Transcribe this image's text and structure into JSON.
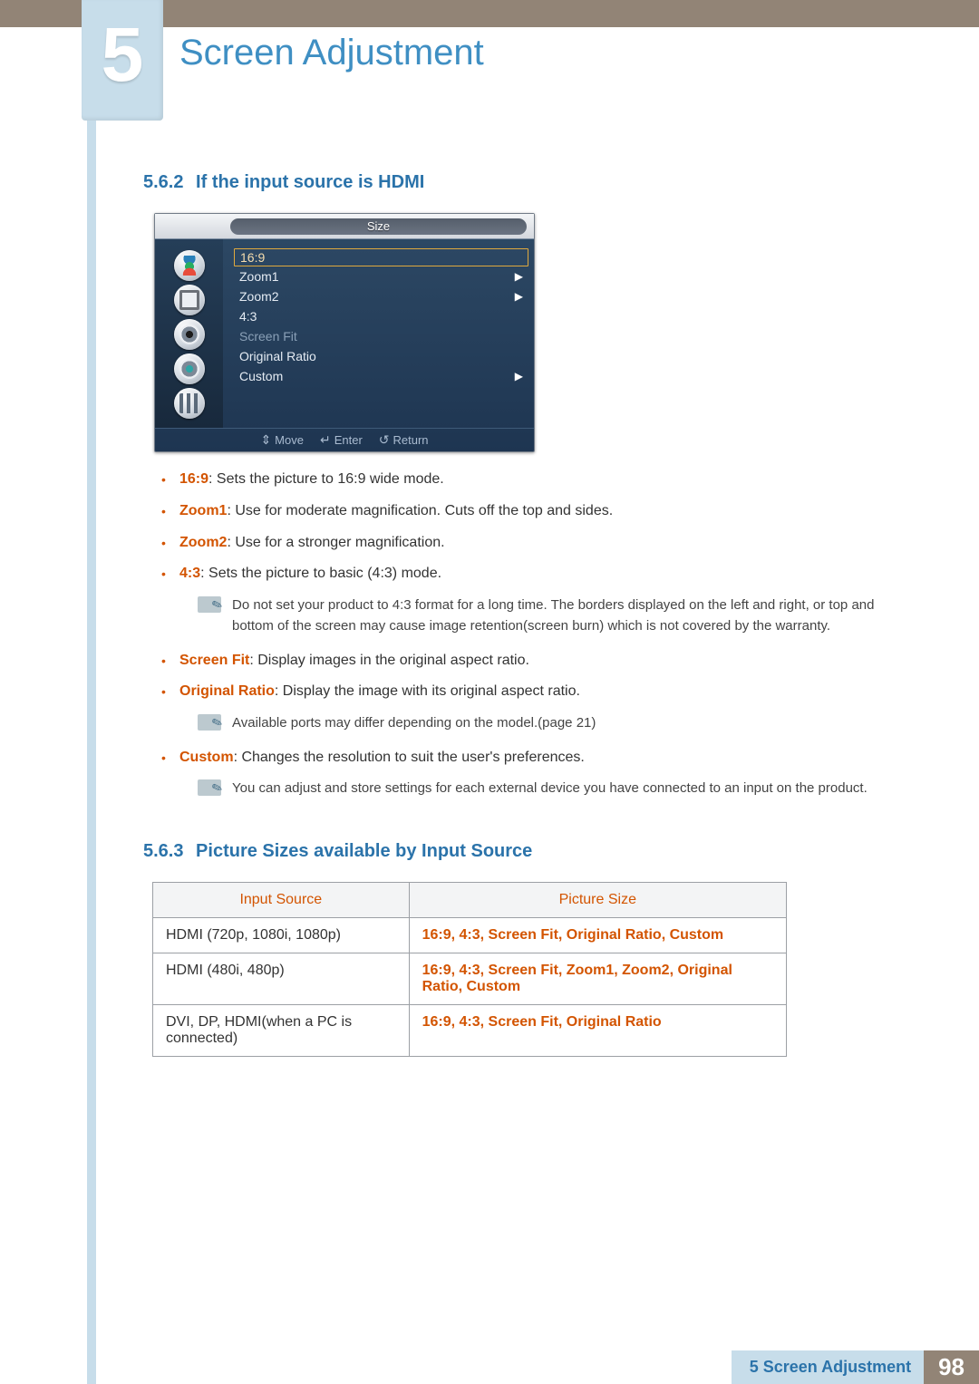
{
  "chapter": {
    "number": "5",
    "title": "Screen Adjustment"
  },
  "section1": {
    "number": "5.6.2",
    "title": "If the input source is HDMI"
  },
  "osd": {
    "title": "Size",
    "items": {
      "item0": {
        "label": "16:9"
      },
      "item1": {
        "label": "Zoom1"
      },
      "item2": {
        "label": "Zoom2"
      },
      "item3": {
        "label": "4:3"
      },
      "item4": {
        "label": "Screen Fit"
      },
      "item5": {
        "label": "Original Ratio"
      },
      "item6": {
        "label": "Custom"
      }
    },
    "footer": {
      "move": "Move",
      "enter": "Enter",
      "return": "Return"
    }
  },
  "bullets": {
    "b0": {
      "term": "16:9",
      "text": ": Sets the picture to 16:9 wide mode."
    },
    "b1": {
      "term": "Zoom1",
      "text": ": Use for moderate magnification. Cuts off the top and sides."
    },
    "b2": {
      "term": "Zoom2",
      "text": ": Use for a stronger magnification."
    },
    "b3": {
      "term": "4:3",
      "text": ": Sets the picture to basic (4:3) mode."
    },
    "note1": "Do not set your product to 4:3 format for a long time. The borders displayed on the left and right, or top and bottom of the screen may cause image retention(screen burn) which is not covered by the warranty.",
    "b4": {
      "term": "Screen Fit",
      "text": ": Display images in the original aspect ratio."
    },
    "b5": {
      "term": "Original Ratio",
      "text": ": Display the image with its original aspect ratio."
    },
    "note2": "Available ports may differ depending on the model.(page 21)",
    "b6": {
      "term": "Custom",
      "text": ": Changes the resolution to suit the user's preferences."
    },
    "note3": "You can adjust and store settings for each external device you have connected to an input on the product."
  },
  "section2": {
    "number": "5.6.3",
    "title": "Picture Sizes available by Input Source"
  },
  "table": {
    "headers": {
      "h0": "Input Source",
      "h1": "Picture Size"
    },
    "rows": {
      "r0": {
        "c0": "HDMI (720p, 1080i, 1080p)",
        "c1": "16:9, 4:3, Screen Fit, Original Ratio, Custom"
      },
      "r1": {
        "c0": "HDMI (480i, 480p)",
        "c1": "16:9, 4:3, Screen Fit, Zoom1, Zoom2, Original Ratio, Custom"
      },
      "r2": {
        "c0": "DVI, DP, HDMI(when a PC is connected)",
        "c1": "16:9, 4:3, Screen Fit, Original Ratio"
      }
    }
  },
  "footer": {
    "label": "5 Screen Adjustment",
    "page": "98"
  }
}
